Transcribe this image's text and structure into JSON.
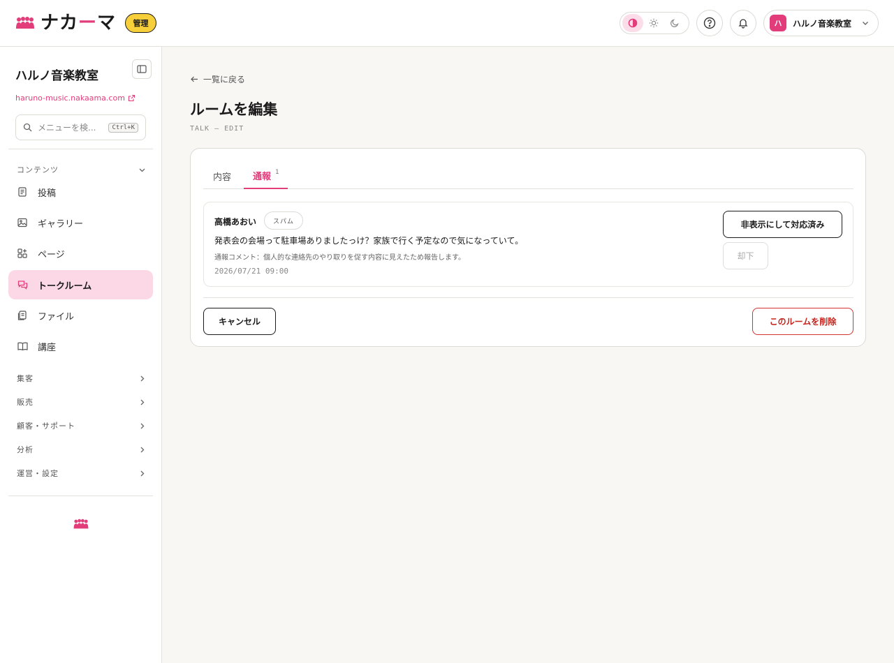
{
  "brand": {
    "logo_dash": "ー",
    "logo_text_pre": "ナカ",
    "logo_text_post": "マ",
    "admin_badge": "管理",
    "accent": "#e23c7b"
  },
  "header": {
    "theme_options": [
      "contrast-icon",
      "sun-icon",
      "moon-icon"
    ],
    "account_avatar": "ハ",
    "account_name": "ハルノ音楽教室"
  },
  "sidebar": {
    "shop_title": "ハルノ音楽教室",
    "shop_url": "haruno-music.nakaama.com",
    "search_placeholder": "メニューを検...",
    "search_shortcut": "Ctrl+K",
    "section_label": "コンテンツ",
    "items": [
      {
        "label": "投稿",
        "icon": "document-icon"
      },
      {
        "label": "ギャラリー",
        "icon": "image-icon"
      },
      {
        "label": "ページ",
        "icon": "pages-icon"
      },
      {
        "label": "トークルーム",
        "icon": "chat-icon",
        "active": true
      },
      {
        "label": "ファイル",
        "icon": "files-icon"
      },
      {
        "label": "講座",
        "icon": "book-icon"
      }
    ],
    "groups": [
      "集客",
      "販売",
      "顧客・サポート",
      "分析",
      "運営・設定"
    ]
  },
  "main": {
    "back_label": "一覧に戻る",
    "title": "ルームを編集",
    "subtitle": "TALK — EDIT",
    "tabs": [
      {
        "label": "内容"
      },
      {
        "label": "通報",
        "count": "1",
        "active": true
      }
    ],
    "report": {
      "user": "高橋あおい",
      "tag": "スパム",
      "message": "発表会の会場って駐車場ありましたっけ？家族で行く予定なので気になっていて。",
      "comment": "通報コメント：個人的な連絡先のやり取りを促す内容に見えたため報告します。",
      "date": "2026/07/21 09:00",
      "resolve_label": "非表示にして対応済み",
      "dismiss_label": "却下"
    },
    "cancel_label": "キャンセル",
    "delete_label": "このルームを削除"
  }
}
